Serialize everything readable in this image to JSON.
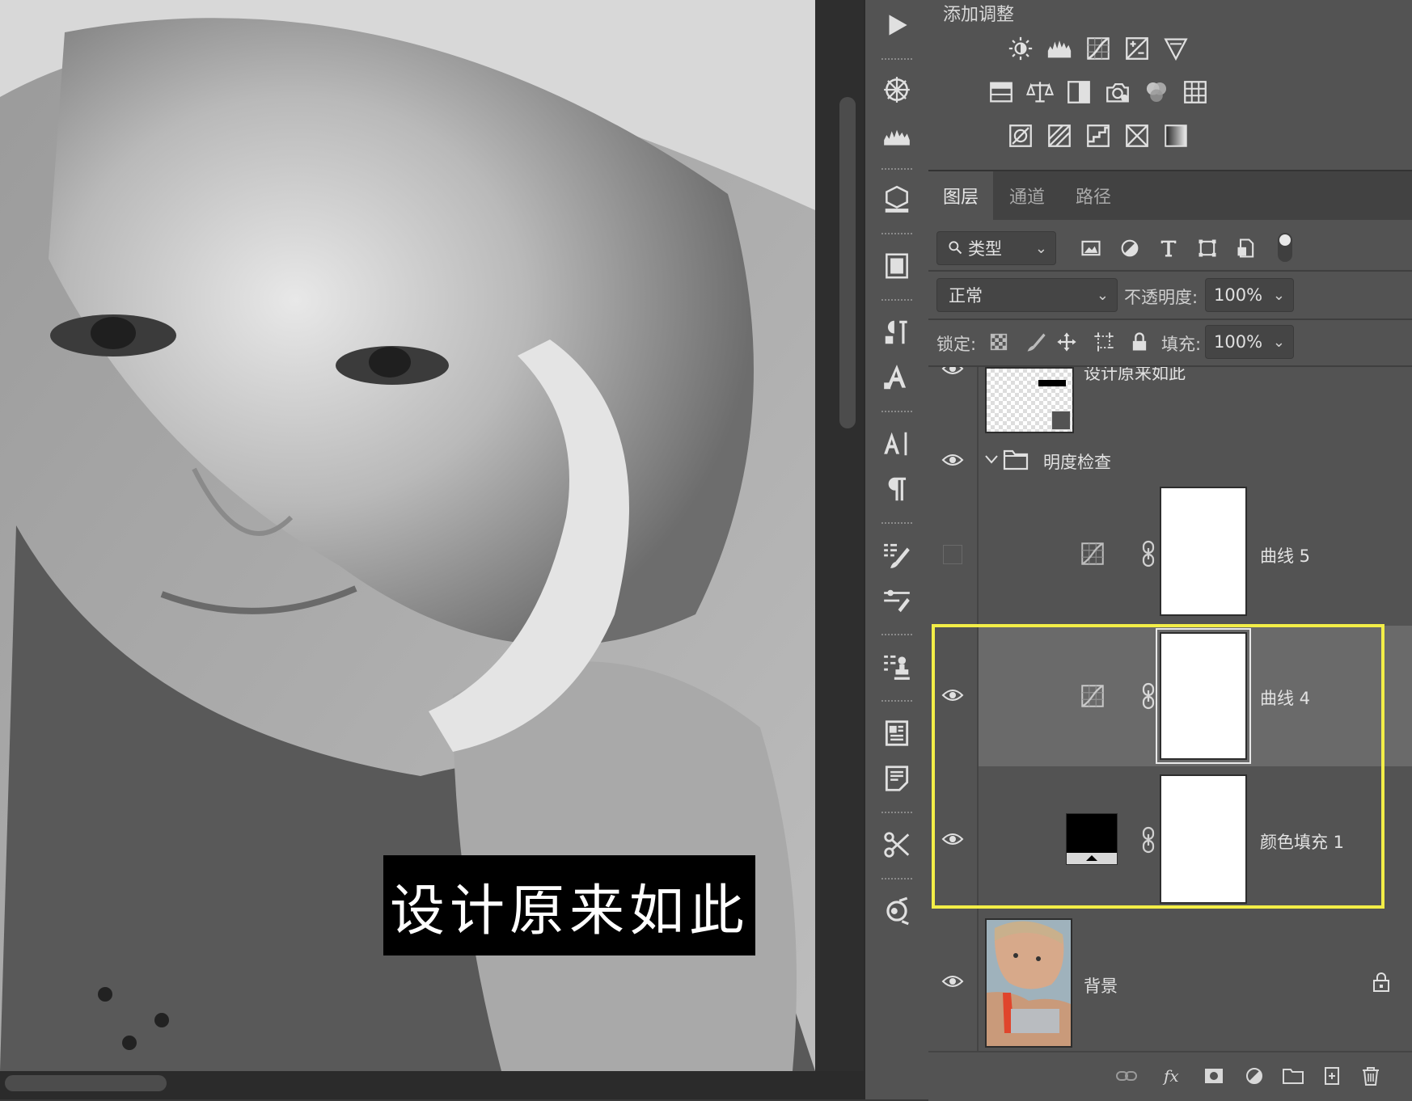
{
  "canvas": {
    "caption": "设计原来如此"
  },
  "adjustments_panel": {
    "title": "添加调整",
    "rows": [
      [
        "brightness-contrast-icon",
        "levels-icon",
        "curves-icon",
        "exposure-icon",
        "vibrance-icon"
      ],
      [
        "hue-saturation-icon",
        "color-balance-icon",
        "black-white-icon",
        "photo-filter-icon",
        "channel-mixer-icon",
        "color-lookup-icon"
      ],
      [
        "invert-icon",
        "posterize-icon",
        "threshold-icon",
        "selective-color-icon",
        "gradient-map-icon"
      ]
    ]
  },
  "layers_panel": {
    "tabs": [
      "图层",
      "通道",
      "路径"
    ],
    "active_tab": "图层",
    "filter_kind": "类型",
    "blend_mode": "正常",
    "opacity_label": "不透明度:",
    "opacity_value": "100%",
    "lock_label": "锁定:",
    "fill_label": "填充:",
    "fill_value": "100%",
    "layers": [
      {
        "name": "设计原来如此",
        "type": "smart-object",
        "visible": true
      },
      {
        "name": "明度检查",
        "type": "group",
        "visible": true,
        "expanded": true
      },
      {
        "name": "曲线 5",
        "type": "curves",
        "visible": false
      },
      {
        "name": "曲线 4",
        "type": "curves",
        "visible": true,
        "selected": true
      },
      {
        "name": "颜色填充 1",
        "type": "color-fill",
        "visible": true,
        "fill_color": "#000000"
      },
      {
        "name": "背景",
        "type": "background",
        "visible": true,
        "locked": true
      }
    ]
  },
  "colors": {
    "highlight": "#f3ee47",
    "panel_bg": "#535353",
    "selected_row": "#6a6a6a"
  }
}
